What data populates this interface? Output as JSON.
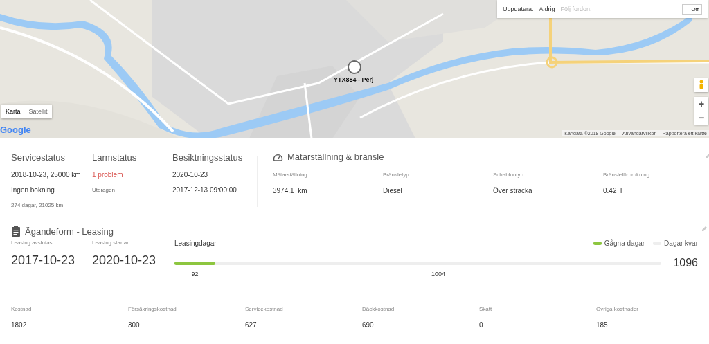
{
  "map": {
    "kind": "picture",
    "map_types": [
      {
        "label": "Karta",
        "selected": true
      },
      {
        "label": "Satellit",
        "selected": false
      }
    ],
    "logo": "Google",
    "attribution": [
      "Kartdata ©2018 Google",
      "Användarvillkor",
      "Rapportera ett kartfe"
    ],
    "marker": {
      "label": "YTX884 - Perj"
    },
    "panel": {
      "update_label": "Uppdatera:",
      "update_value": "Aldrig",
      "follow_label": "Följ fordon:",
      "follow": {
        "label": "Off",
        "on": false
      }
    },
    "zoom": [
      "+",
      "−"
    ]
  },
  "status": [
    {
      "title": "Servicestatus",
      "lines": [
        {
          "text": "2018-10-23, 25000 km",
          "kind": "value"
        },
        {
          "text": "Ingen bokning",
          "kind": "value"
        },
        {
          "text": "274 dagar, 21025 km",
          "kind": "small"
        }
      ]
    },
    {
      "title": "Larmstatus",
      "lines": [
        {
          "text": "1 problem",
          "kind": "alert"
        },
        {
          "text": "Utdragen",
          "kind": "small"
        }
      ]
    },
    {
      "title": "Besiktningsstatus",
      "lines": [
        {
          "text": "2020-10-23",
          "kind": "value"
        },
        {
          "text": "2017-12-13 09:00:00",
          "kind": "value"
        }
      ]
    }
  ],
  "meter": {
    "title": "Mätarställning & bränsle",
    "fields": [
      {
        "label": "Mätarställning",
        "value": "3974.1  km"
      },
      {
        "label": "Bränsletyp",
        "value": "Diesel"
      },
      {
        "label": "Schablontyp",
        "value": "Över sträcka"
      },
      {
        "label": "Bränsleförbrukning",
        "value": "0.42  l"
      }
    ]
  },
  "leasing": {
    "title": "Ägandeform - Leasing",
    "dates": [
      {
        "label": "Leasing avslutas",
        "value": "2017-10-23"
      },
      {
        "label": "Leasing startar",
        "value": "2020-10-23"
      }
    ],
    "bar": {
      "title": "Leasingdagar",
      "legend": [
        {
          "label": "Gågna dagar",
          "color": "#8dc63f"
        },
        {
          "label": "Dagar kvar",
          "color": "#eeeeee"
        }
      ],
      "level": 0.084,
      "passed": "92",
      "remaining": "1004",
      "total": "1096"
    }
  },
  "costs": [
    {
      "label": "Kostnad",
      "value": "1802"
    },
    {
      "label": "Försäkringskostnad",
      "value": "300"
    },
    {
      "label": "Servicekostnad",
      "value": "627"
    },
    {
      "label": "Däckkostnad",
      "value": "690"
    },
    {
      "label": "Skatt",
      "value": "0"
    },
    {
      "label": "Övriga kostnader",
      "value": "185"
    }
  ]
}
